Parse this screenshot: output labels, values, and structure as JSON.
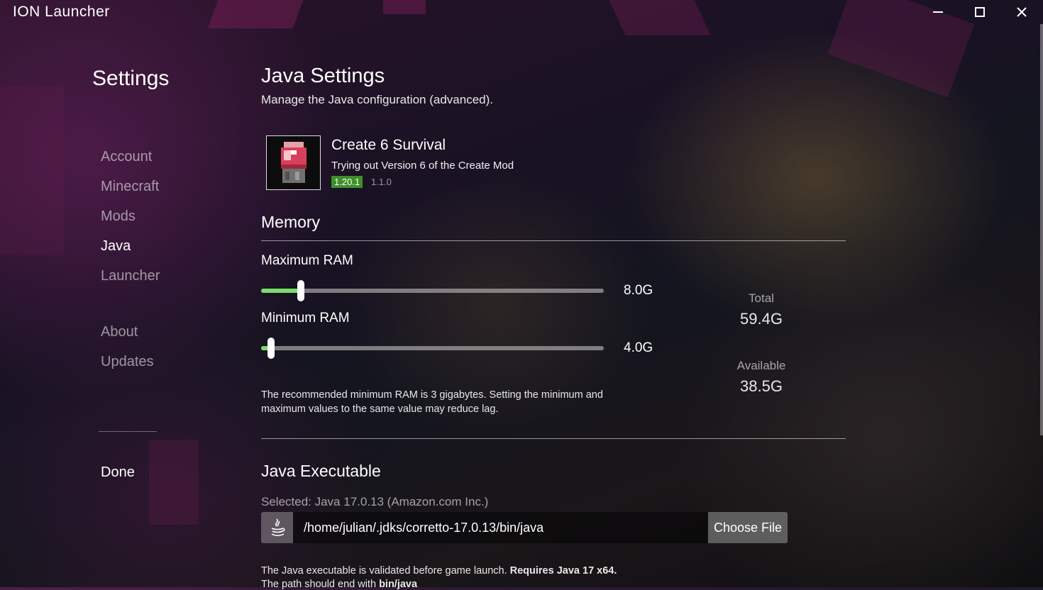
{
  "window": {
    "title": "ION Launcher"
  },
  "sidebar": {
    "title": "Settings",
    "items": [
      {
        "label": "Account",
        "active": false
      },
      {
        "label": "Minecraft",
        "active": false
      },
      {
        "label": "Mods",
        "active": false
      },
      {
        "label": "Java",
        "active": true
      },
      {
        "label": "Launcher",
        "active": false
      },
      {
        "label": "About",
        "active": false
      },
      {
        "label": "Updates",
        "active": false
      }
    ],
    "done_label": "Done"
  },
  "main": {
    "title": "Java Settings",
    "subtitle": "Manage the Java configuration (advanced).",
    "modpack": {
      "name": "Create 6 Survival",
      "description": "Trying out Version 6 of the Create Mod",
      "mc_version": "1.20.1",
      "version": "1.1.0"
    },
    "memory": {
      "title": "Memory",
      "max_label": "Maximum RAM",
      "max_value": "8.0G",
      "max_fraction": 0.116,
      "min_label": "Minimum RAM",
      "min_value": "4.0G",
      "min_fraction": 0.03,
      "total_label": "Total",
      "total_value": "59.4G",
      "available_label": "Available",
      "available_value": "38.5G",
      "note": "The recommended minimum RAM is 3 gigabytes. Setting the minimum and maximum values to the same value may reduce lag."
    },
    "executable": {
      "title": "Java Executable",
      "selected": "Selected: Java 17.0.13 (Amazon.com Inc.)",
      "path": "/home/julian/.jdks/corretto-17.0.13/bin/java",
      "choose_label": "Choose File",
      "footer_prefix": "The Java executable is validated before game launch.",
      "footer_bold": "Requires Java 17 x64.",
      "footer2_prefix": "The path should end with",
      "footer2_bold": "bin/java"
    }
  },
  "colors": {
    "slider_fill": "#7bdc6e",
    "mc_badge": "#3f8f2a"
  },
  "icons": [
    "minimize-icon",
    "maximize-icon",
    "close-icon",
    "java-icon",
    "modpack-icon"
  ]
}
